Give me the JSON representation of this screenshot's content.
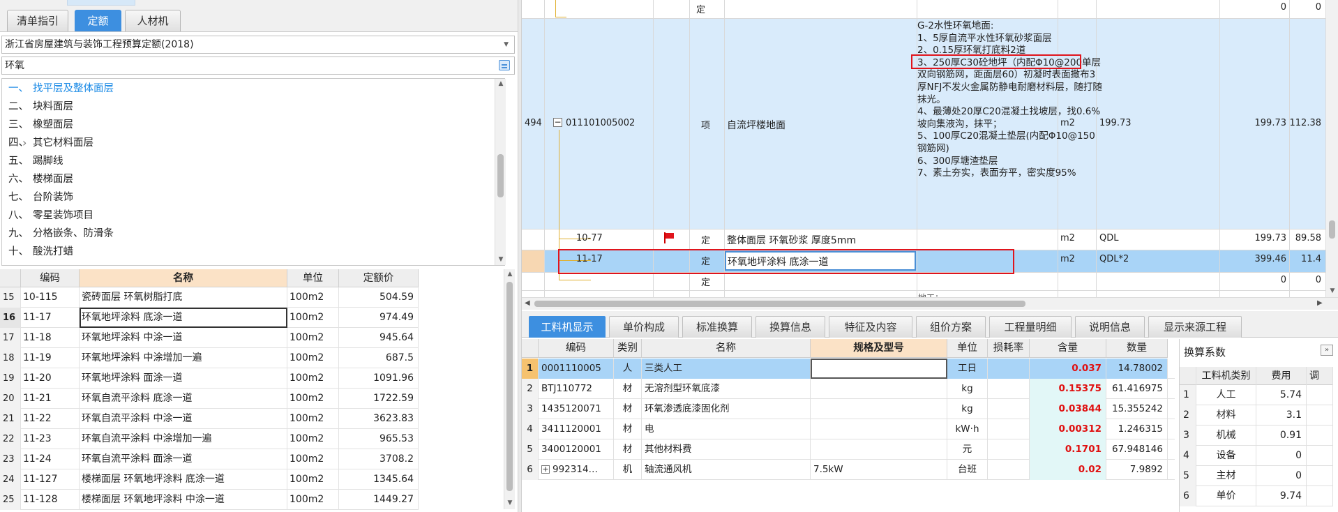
{
  "left_tabs": [
    {
      "label": "清单指引",
      "active": false
    },
    {
      "label": "定额",
      "active": true
    },
    {
      "label": "人材机",
      "active": false
    }
  ],
  "quota_library": "浙江省房屋建筑与装饰工程预算定额(2018)",
  "search_value": "环氧",
  "tree_items": [
    {
      "num": "一、",
      "label": "找平层及整体面层",
      "selected": true,
      "expandable": false
    },
    {
      "num": "二、",
      "label": "块料面层",
      "selected": false,
      "expandable": false
    },
    {
      "num": "三、",
      "label": "橡塑面层",
      "selected": false,
      "expandable": false
    },
    {
      "num": "四、",
      "label": "其它材料面层",
      "selected": false,
      "expandable": true
    },
    {
      "num": "五、",
      "label": "踢脚线",
      "selected": false,
      "expandable": false
    },
    {
      "num": "六、",
      "label": "楼梯面层",
      "selected": false,
      "expandable": false
    },
    {
      "num": "七、",
      "label": "台阶装饰",
      "selected": false,
      "expandable": false
    },
    {
      "num": "八、",
      "label": "零星装饰项目",
      "selected": false,
      "expandable": false
    },
    {
      "num": "九、",
      "label": "分格嵌条、防滑条",
      "selected": false,
      "expandable": false
    },
    {
      "num": "十、",
      "label": "酸洗打蜡",
      "selected": false,
      "expandable": false
    }
  ],
  "quota_table": {
    "headers": [
      "编码",
      "名称",
      "单位",
      "定额价"
    ],
    "rows": [
      {
        "idx": "15",
        "code": "10-115",
        "name": "瓷砖面层 环氧树脂打底",
        "unit": "100m2",
        "price": "504.59"
      },
      {
        "idx": "16",
        "code": "11-17",
        "name": "环氧地坪涂料 底涂一道",
        "unit": "100m2",
        "price": "974.49",
        "current": true
      },
      {
        "idx": "17",
        "code": "11-18",
        "name": "环氧地坪涂料 中涂一道",
        "unit": "100m2",
        "price": "945.64"
      },
      {
        "idx": "18",
        "code": "11-19",
        "name": "环氧地坪涂料 中涂增加一遍",
        "unit": "100m2",
        "price": "687.5"
      },
      {
        "idx": "19",
        "code": "11-20",
        "name": "环氧地坪涂料 面涂一道",
        "unit": "100m2",
        "price": "1091.96"
      },
      {
        "idx": "20",
        "code": "11-21",
        "name": "环氧自流平涂料 底涂一道",
        "unit": "100m2",
        "price": "1722.59"
      },
      {
        "idx": "21",
        "code": "11-22",
        "name": "环氧自流平涂料 中涂一道",
        "unit": "100m2",
        "price": "3623.83"
      },
      {
        "idx": "22",
        "code": "11-23",
        "name": "环氧自流平涂料 中涂增加一遍",
        "unit": "100m2",
        "price": "965.53"
      },
      {
        "idx": "23",
        "code": "11-24",
        "name": "环氧自流平涂料 面涂一道",
        "unit": "100m2",
        "price": "3708.2"
      },
      {
        "idx": "24",
        "code": "11-127",
        "name": "楼梯面层 环氧地坪涂料 底涂一道",
        "unit": "100m2",
        "price": "1345.64"
      },
      {
        "idx": "25",
        "code": "11-128",
        "name": "楼梯面层 环氧地坪涂料 中涂一道",
        "unit": "100m2",
        "price": "1449.27"
      }
    ]
  },
  "grid": {
    "top_row": {
      "type": "定",
      "v1": "0",
      "v2": "0"
    },
    "item_row": {
      "idx": "494",
      "code": "011101005002",
      "type": "项",
      "name": "自流坪楼地面",
      "unit": "m2",
      "qty": "199.73",
      "v1": "199.73",
      "v2": "112.38",
      "desc_lines": [
        "G-2水性环氧地面:",
        "1、5厚自流平水性环氧砂浆面层",
        "2、0.15厚环氧打底料2道",
        "3、250厚C30砼地坪（内配Φ10@200单层双向钢筋网，距面层60）初凝时表面撒布3厚NFJ不发火金属防静电耐磨材料层，随打随抹光。",
        "4、最薄处20厚C20混凝土找坡层，找0.6%坡向集液沟，抹平；",
        "5、100厚C20混凝土垫层(内配Φ10@150钢筋网)",
        "6、300厚塘渣垫层",
        "7、素土夯实，表面夯平，密实度95%"
      ]
    },
    "sub_rows": [
      {
        "code": "10-77",
        "type": "定",
        "name": "整体面层 环氧砂浆 厚度5mm",
        "unit": "m2",
        "qty_expr": "QDL",
        "v1": "199.73",
        "v2": "89.58",
        "flag": true
      },
      {
        "code": "11-17",
        "type": "定",
        "name": "环氧地坪涂料 底涂一道",
        "unit": "m2",
        "qty_expr": "QDL*2",
        "v1": "399.46",
        "v2": "11.4",
        "selected": true
      }
    ],
    "bottom_row": {
      "type": "定",
      "v1": "0",
      "v2": "0"
    },
    "cut_text": "地工："
  },
  "bottom_tabs": [
    {
      "label": "工料机显示",
      "active": true
    },
    {
      "label": "单价构成",
      "active": false
    },
    {
      "label": "标准换算",
      "active": false
    },
    {
      "label": "换算信息",
      "active": false
    },
    {
      "label": "特征及内容",
      "active": false
    },
    {
      "label": "组价方案",
      "active": false
    },
    {
      "label": "工程量明细",
      "active": false
    },
    {
      "label": "说明信息",
      "active": false
    },
    {
      "label": "显示来源工程",
      "active": false
    }
  ],
  "resource_table": {
    "headers": [
      "编码",
      "类别",
      "名称",
      "规格及型号",
      "单位",
      "损耗率",
      "含量",
      "数量"
    ],
    "rows": [
      {
        "idx": "1",
        "code": "0001110005",
        "cat": "人",
        "name": "三类人工",
        "spec": "",
        "unit": "工日",
        "loss": "",
        "content": "0.037",
        "qty": "14.78002",
        "current": true
      },
      {
        "idx": "2",
        "code": "BTJ110772",
        "cat": "材",
        "name": "无溶剂型环氧底漆",
        "spec": "",
        "unit": "kg",
        "loss": "",
        "content": "0.15375",
        "qty": "61.416975"
      },
      {
        "idx": "3",
        "code": "1435120071",
        "cat": "材",
        "name": "环氧渗透底漆固化剂",
        "spec": "",
        "unit": "kg",
        "loss": "",
        "content": "0.03844",
        "qty": "15.355242"
      },
      {
        "idx": "4",
        "code": "3411120001",
        "cat": "材",
        "name": "电",
        "spec": "",
        "unit": "kW·h",
        "loss": "",
        "content": "0.00312",
        "qty": "1.246315"
      },
      {
        "idx": "5",
        "code": "3400120001",
        "cat": "材",
        "name": "其他材料费",
        "spec": "",
        "unit": "元",
        "loss": "",
        "content": "0.1701",
        "qty": "67.948146"
      },
      {
        "idx": "6",
        "code": "992314…",
        "cat": "机",
        "name": "轴流通风机",
        "spec": "7.5kW",
        "unit": "台班",
        "loss": "",
        "content": "0.02",
        "qty": "7.9892",
        "expandable": true
      }
    ]
  },
  "coef_panel": {
    "title": "换算系数",
    "headers": [
      "工料机类别",
      "费用",
      "调"
    ],
    "rows": [
      {
        "idx": "1",
        "cat": "人工",
        "fee": "5.74"
      },
      {
        "idx": "2",
        "cat": "材料",
        "fee": "3.1"
      },
      {
        "idx": "3",
        "cat": "机械",
        "fee": "0.91"
      },
      {
        "idx": "4",
        "cat": "设备",
        "fee": "0"
      },
      {
        "idx": "5",
        "cat": "主材",
        "fee": "0"
      },
      {
        "idx": "6",
        "cat": "单价",
        "fee": "9.74"
      }
    ]
  },
  "colors": {
    "accent": "#3d8fe0",
    "selected_row": "#a9d4f7",
    "item_bg": "#d9ebfb",
    "highlight_header": "#fbe2c6",
    "red": "#e0141c"
  }
}
